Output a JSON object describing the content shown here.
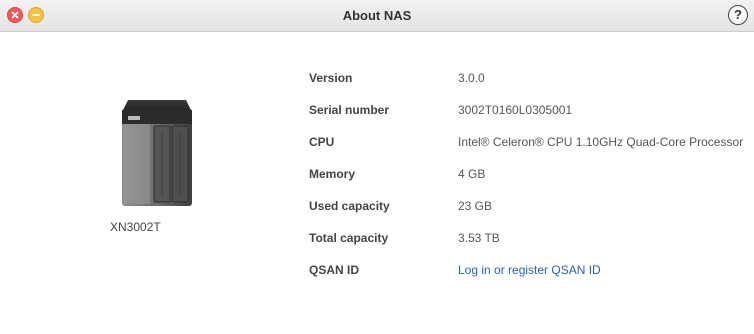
{
  "window": {
    "title": "About NAS",
    "help_label": "?"
  },
  "device": {
    "model": "XN3002T",
    "logo_text": "QSAN"
  },
  "info": [
    {
      "label": "Version",
      "value": "3.0.0"
    },
    {
      "label": "Serial number",
      "value": "3002T0160L0305001"
    },
    {
      "label": "CPU",
      "value": "Intel® Celeron® CPU 1.10GHz Quad-Core Processor"
    },
    {
      "label": "Memory",
      "value": "4 GB"
    },
    {
      "label": "Used capacity",
      "value": "23 GB"
    },
    {
      "label": "Total capacity",
      "value": "3.53 TB"
    },
    {
      "label": "QSAN ID",
      "value": "Log in or register QSAN ID"
    }
  ],
  "colors": {
    "link": "#2a5fb8",
    "close": "#f05a5a",
    "minimize": "#f6c245"
  }
}
